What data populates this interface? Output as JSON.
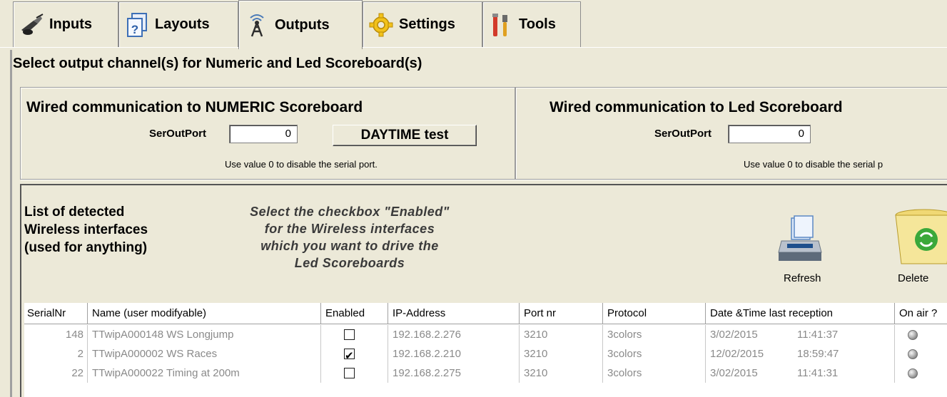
{
  "tabs": [
    {
      "label": "Inputs",
      "icon": "antenna-icon"
    },
    {
      "label": "Layouts",
      "icon": "help-document-icon"
    },
    {
      "label": "Outputs",
      "icon": "broadcast-tower-icon"
    },
    {
      "label": "Settings",
      "icon": "gear-icon"
    },
    {
      "label": "Tools",
      "icon": "tools-icon"
    }
  ],
  "section_title": "Select output channel(s) for Numeric and Led Scoreboard(s)",
  "numeric": {
    "title": "Wired communication to NUMERIC Scoreboard",
    "port_label": "SerOutPort",
    "port_value": "0",
    "daytime_button": "DAYTIME test",
    "hint": "Use value 0 to disable the serial port."
  },
  "led": {
    "title": "Wired communication to Led Scoreboard",
    "port_label": "SerOutPort",
    "port_value": "0",
    "hint": "Use value 0 to disable the serial p"
  },
  "wireless": {
    "title_lines": [
      "List of detected",
      "Wireless interfaces",
      "(used for anything)"
    ],
    "instruction_lines": [
      "Select the checkbox \"Enabled\"",
      "for the Wireless interfaces",
      "which you want to drive the",
      "Led Scoreboards"
    ],
    "refresh_label": "Refresh",
    "delete_label": "Delete"
  },
  "table": {
    "columns": [
      "SerialNr",
      "Name (user modifyable)",
      "Enabled",
      "IP-Address",
      "Port nr",
      "Protocol",
      "Date &Time last reception",
      "On air ?"
    ],
    "rows": [
      {
        "serial": "148",
        "name": "TTwipA000148 WS Longjump",
        "enabled": false,
        "ip": "192.168.2.276",
        "port": "3210",
        "protocol": "3colors",
        "date": "3/02/2015",
        "time": "11:41:37"
      },
      {
        "serial": "2",
        "name": "TTwipA000002 WS Races",
        "enabled": true,
        "ip": "192.168.2.210",
        "port": "3210",
        "protocol": "3colors",
        "date": "12/02/2015",
        "time": "18:59:47"
      },
      {
        "serial": "22",
        "name": "TTwipA000022 Timing at 200m",
        "enabled": false,
        "ip": "192.168.2.275",
        "port": "3210",
        "protocol": "3colors",
        "date": "3/02/2015",
        "time": "11:41:31"
      }
    ]
  }
}
